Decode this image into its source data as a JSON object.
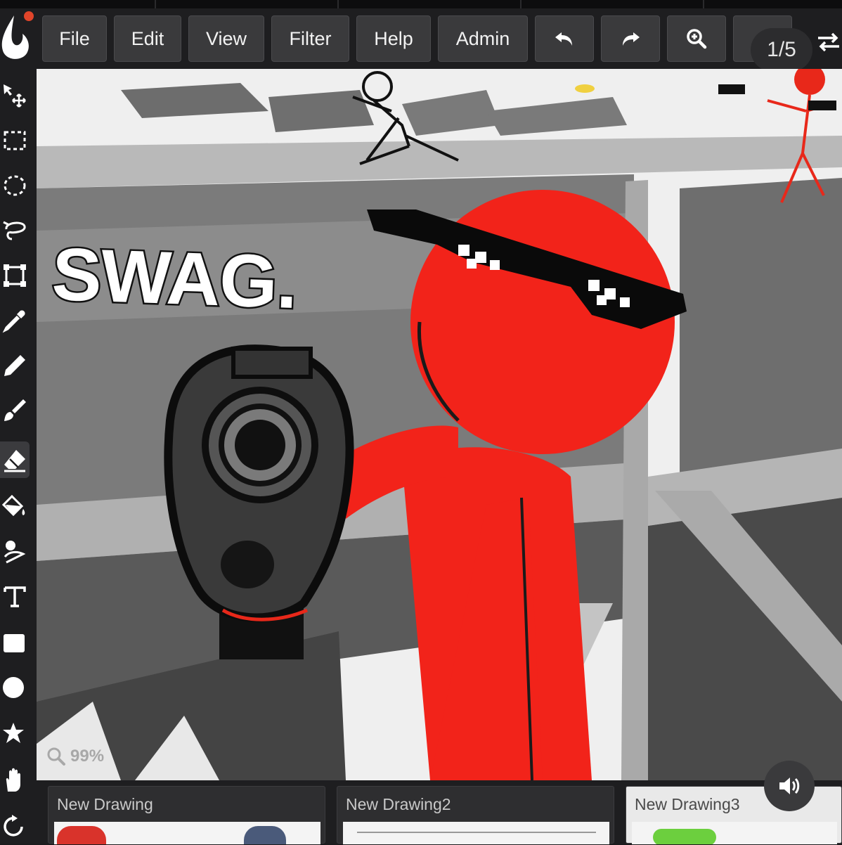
{
  "menu": {
    "file": "File",
    "edit": "Edit",
    "view": "View",
    "filter": "Filter",
    "help": "Help",
    "admin": "Admin"
  },
  "toolbar_icons": [
    "undo-icon",
    "redo-icon",
    "zoom-in-icon",
    "swap-icon"
  ],
  "pager": "1/5",
  "tools": [
    "move-tool",
    "rect-select-tool",
    "ellipse-select-tool",
    "lasso-tool",
    "transform-tool",
    "eyedropper-tool",
    "pencil-tool",
    "brush-tool",
    "eraser-tool",
    "fill-tool",
    "smudge-tool",
    "text-tool",
    "rectangle-tool",
    "ellipse-tool",
    "star-tool",
    "hand-tool",
    "rotate-tool"
  ],
  "active_tool": "eraser-tool",
  "canvas": {
    "caption": "SWAG.",
    "zoom": "99%"
  },
  "drawings": [
    {
      "label": "New Drawing"
    },
    {
      "label": "New Drawing2"
    },
    {
      "label": "New Drawing3"
    }
  ],
  "colors": {
    "accent": "#e0452a",
    "figure": "#f2231a",
    "toolbar_bg": "#1e1e20",
    "button_bg": "#3a3a3c"
  }
}
